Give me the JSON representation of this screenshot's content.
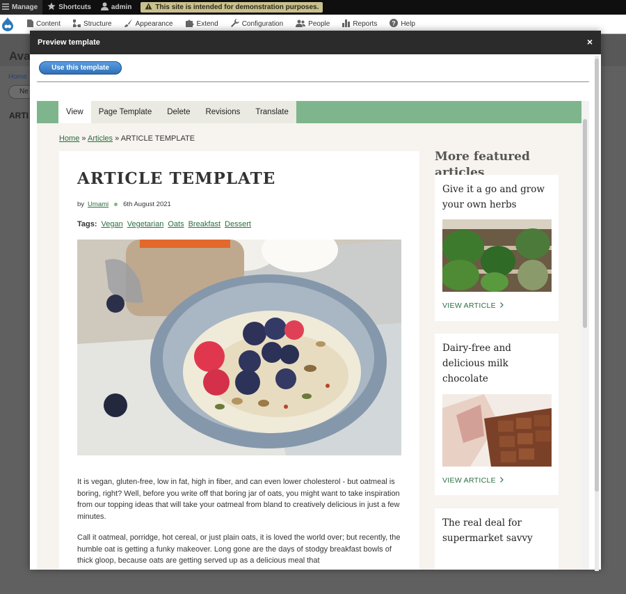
{
  "toolbar": {
    "manage": "Manage",
    "shortcuts": "Shortcuts",
    "user": "admin",
    "notice": "This site is intended for demonstration purposes.",
    "tray": [
      "Content",
      "Structure",
      "Appearance",
      "Extend",
      "Configuration",
      "People",
      "Reports",
      "Help"
    ]
  },
  "behind": {
    "title": "Ava",
    "crumb": "Home",
    "button": "Ne",
    "article": "ARTI"
  },
  "dialog": {
    "title": "Preview template",
    "close": "×",
    "use_button": "Use this template"
  },
  "preview": {
    "tabs": [
      "View",
      "Page Template",
      "Delete",
      "Revisions",
      "Translate"
    ],
    "breadcrumb": {
      "home": "Home",
      "sep": "»",
      "articles": "Articles",
      "current": "ARTICLE TEMPLATE"
    },
    "article": {
      "title": "ARTICLE TEMPLATE",
      "by": "by",
      "author": "Umami",
      "date": "6th August 2021",
      "tags_label": "Tags:",
      "tags": [
        "Vegan",
        "Vegetarian",
        "Oats",
        "Breakfast",
        "Dessert"
      ],
      "p1": "It is vegan, gluten-free, low in fat, high in fiber, and can even lower cholesterol - but oatmeal is boring, right? Well, before you write off that boring jar of oats, you might want to take inspiration from our topping ideas that will take your oatmeal from bland to creatively delicious in just a few minutes.",
      "p2": "Call it oatmeal, porridge, hot cereal, or just plain oats, it is loved the world over; but recently, the humble oat is getting a funky makeover. Long gone are the days of stodgy breakfast bowls of thick gloop, because oats are getting served up as a delicious meal that"
    },
    "sidebar": {
      "title": "More featured articles",
      "cards": [
        {
          "title": "Give it a go and grow your own herbs",
          "link": "VIEW ARTICLE"
        },
        {
          "title": "Dairy-free and delicious milk chocolate",
          "link": "VIEW ARTICLE"
        },
        {
          "title": "The real deal for supermarket savvy",
          "link": ""
        }
      ]
    }
  }
}
